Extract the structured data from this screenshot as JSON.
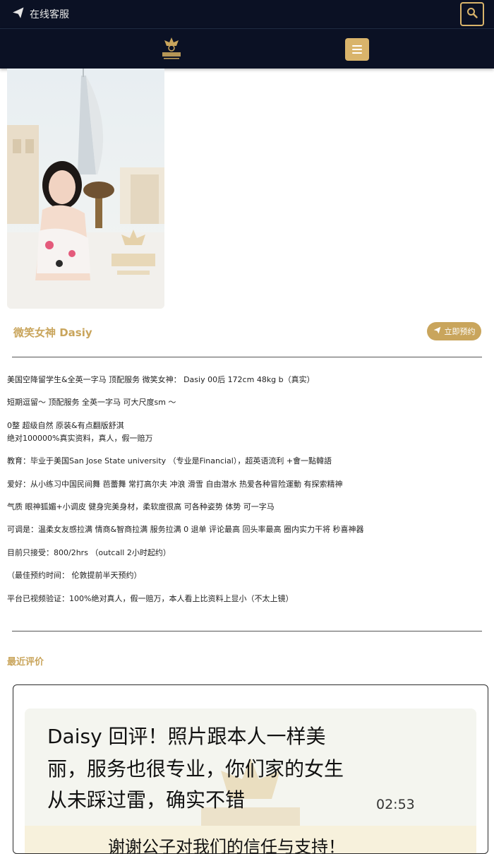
{
  "topbar": {
    "customer_service_label": "在线客服",
    "icons": {
      "send": "send-icon",
      "search": "search-icon"
    }
  },
  "header": {
    "logo_name": "帝王之夜",
    "icons": {
      "menu": "hamburger-menu-icon"
    }
  },
  "colors": {
    "navy": "#0b1124",
    "gold": "#c9a55c",
    "gold_light": "#d9b46b"
  },
  "profile": {
    "name": "微笑女神 Dasiy",
    "book_button_label": "立即预约",
    "description": [
      "美国空降留学生&全英一字马 顶配服务 微笑女神： Dasiy 00后 172cm 48kg b（真实）",
      "短期逗留～ 顶配服务 全英一字马 可大尺度sm ～",
      "0整 超级自然 原装&有点翻版舒淇",
      "绝对100000%真实资料，真人，假一赔万",
      "教育：毕业于美国San Jose State university （专业是Financial），超英语流利 +會一點韓語",
      "爱好：从小练习中国民间舞 芭蕾舞 常打高尔夫 冲浪 滑雪 自由潜水 热爱各种冒险運動 有探索精神",
      "气质 眼神狐媚+小调皮 健身完美身材，柔软度很高 可各种姿势 体势 可一字马",
      "可调是：温柔女友感拉满 情商&智商拉满 服务拉满 0 退单 评论最高 回头率最高 圈内实力干将 秒喜神器",
      "目前只接受：800/2hrs （outcall 2小时起约）",
      "（最佳预约时间： 伦敦提前半天预约）",
      "平台已视频验证：100%绝对真人，假一赔万，本人看上比资料上显小（不太上镜）"
    ]
  },
  "reviews": {
    "heading": "最近评价",
    "items": [
      {
        "lines": [
          "Daisy 回评！照片跟本人一样美",
          "丽，服务也很专业，你们家的女生",
          "从未踩过雷，确实不错"
        ],
        "time": "02:53",
        "reply": "谢谢公子对我们的信任与支持！"
      }
    ]
  }
}
